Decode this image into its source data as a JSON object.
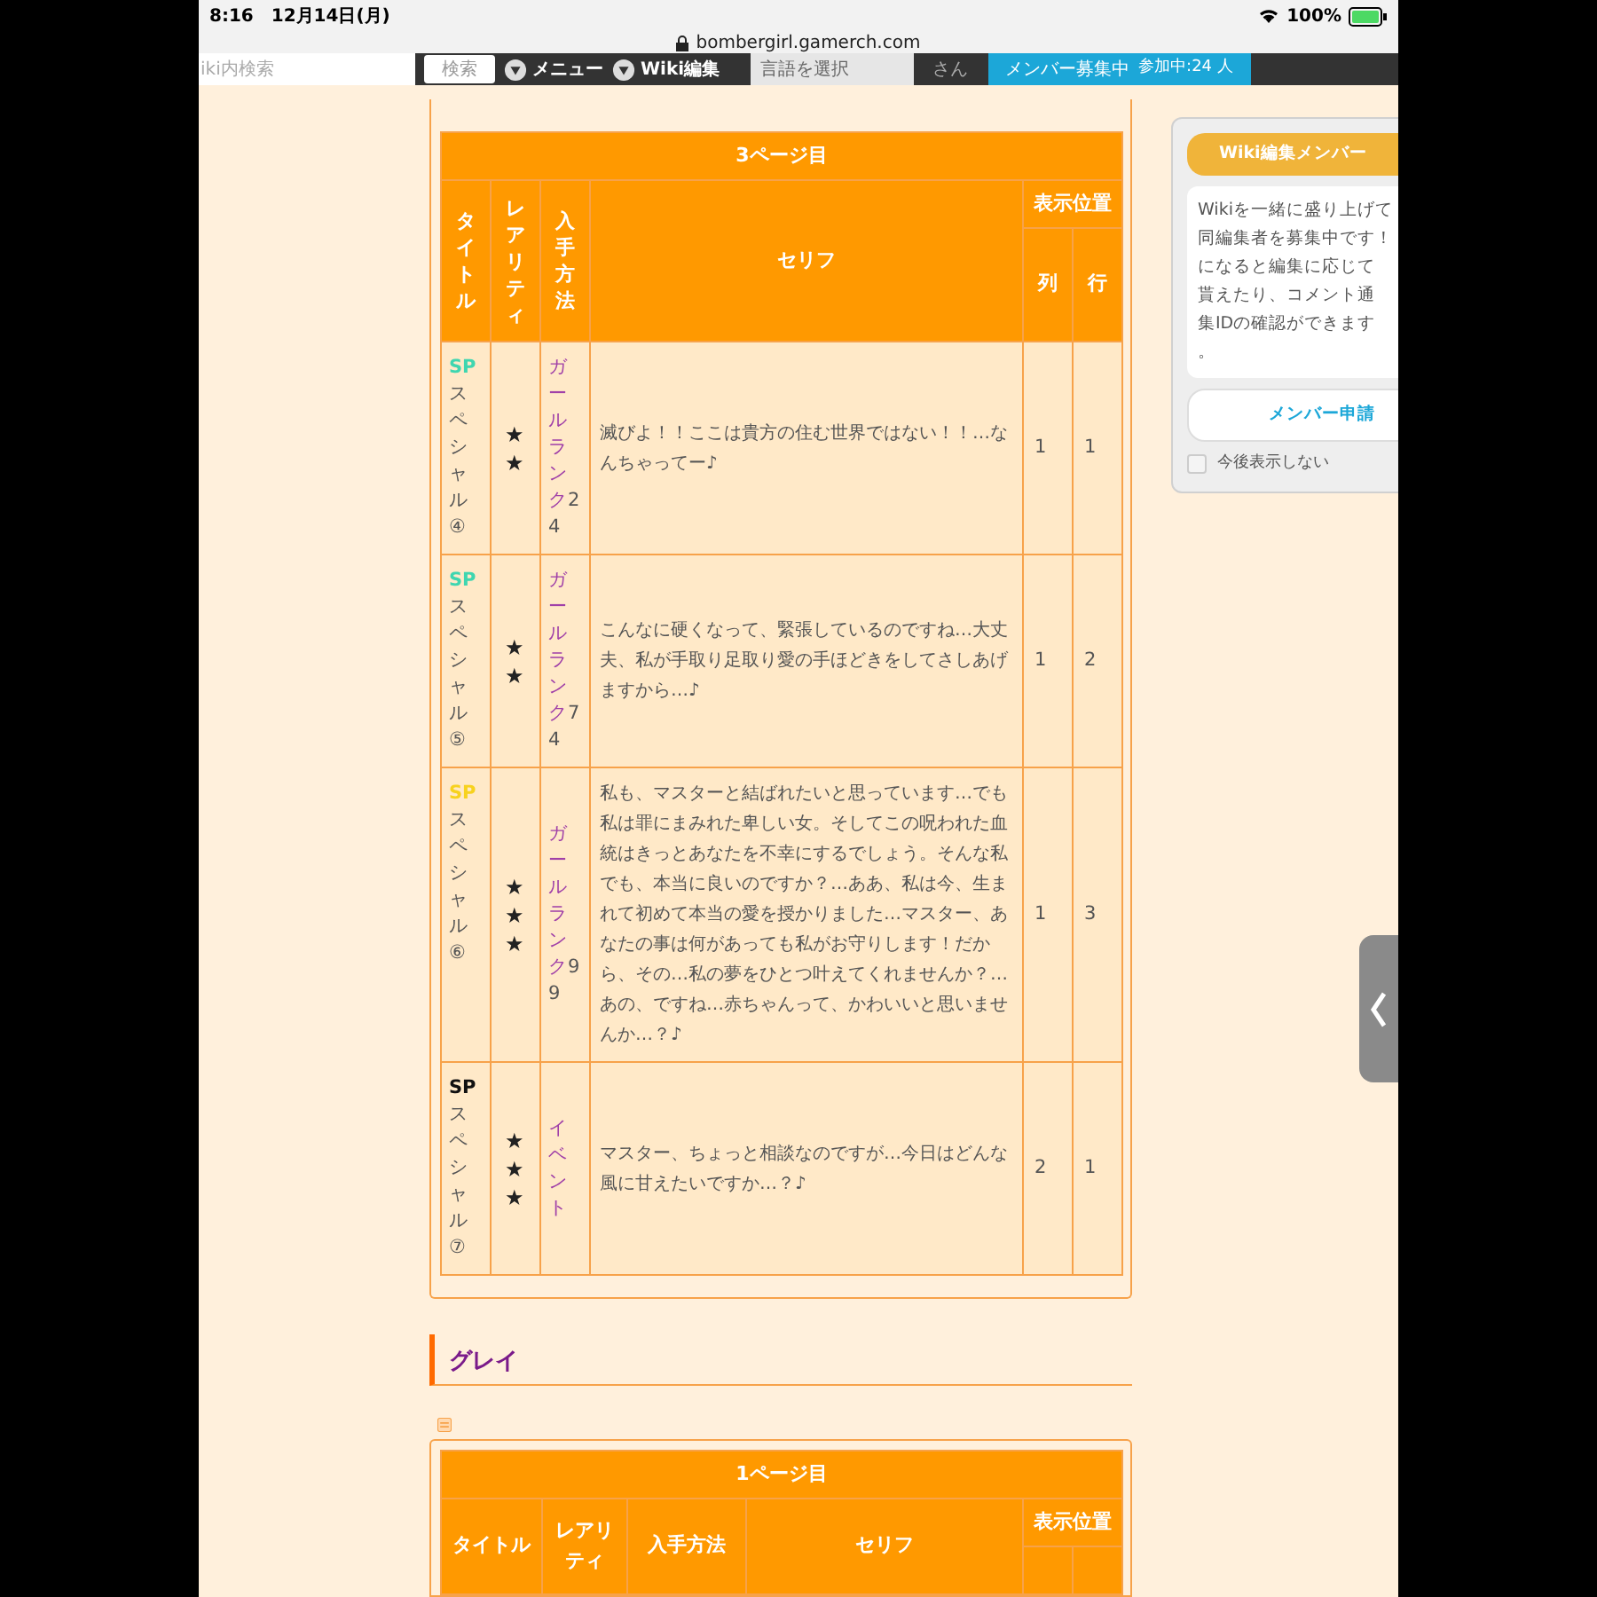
{
  "status_bar": {
    "time": "8:16",
    "date": "12月14日(月)",
    "battery": "100%"
  },
  "address_bar": {
    "url": "bombergirl.gamerch.com"
  },
  "nav": {
    "search_placeholder": "iki内検索",
    "search_button": "検索",
    "menus": [
      "メニュー",
      "Wiki編集"
    ],
    "language": "言語を選択",
    "user_suffix": "さん",
    "member_button": {
      "label": "メンバー募集中",
      "count": "参加中:24 人"
    }
  },
  "table_1": {
    "caption": "3ページ目",
    "headers": {
      "title": "タイトル",
      "rarity": "レアリティ",
      "method": "入手方法",
      "line": "セリフ",
      "position": "表示位置",
      "column": "列",
      "row": "行"
    },
    "rows": [
      {
        "sp": "SP",
        "color": "#3fd6b0",
        "name": "スペシャル④",
        "rarity": "★★",
        "method": "ガールランク",
        "method_value": "24",
        "line": "滅びよ！！ここは貴方の住む世界ではない！！…なんちゃってー♪",
        "column": "1",
        "row": "1"
      },
      {
        "sp": "SP",
        "color": "#3fd6b0",
        "name": "スペシャル⑤",
        "rarity": "★★",
        "method": "ガールランク",
        "method_value": "74",
        "line": "こんなに硬くなって、緊張しているのですね…大丈夫、私が手取り足取り愛の手ほどきをしてさしあげますから…♪",
        "column": "1",
        "row": "2"
      },
      {
        "sp": "SP",
        "color": "#f7d21e",
        "name": "スペシャル⑥",
        "rarity": "★★★",
        "method": "ガールランク",
        "method_value": "99",
        "line": "私も、マスターと結ばれたいと思っています…でも私は罪にまみれた卑しい女。そしてこの呪われた血統はきっとあなたを不幸にするでしょう。そんな私でも、本当に良いのですか？…ああ、私は今、生まれて初めて本当の愛を授かりました…マスター、あなたの事は何があっても私がお守りします！だから、その…私の夢をひとつ叶えてくれませんか？…あの、ですね…赤ちゃんって、かわいいと思いませんか…？♪",
        "column": "1",
        "row": "3"
      },
      {
        "sp": "SP",
        "color": "#111111",
        "name": "スペシャル⑦",
        "rarity": "★★★",
        "method": "イベント",
        "line": "マスター、ちょっと相談なのですが…今日はどんな風に甘えたいですか…？♪",
        "column": "2",
        "row": "1"
      }
    ]
  },
  "heading": "グレイ",
  "table_2": {
    "caption": "1ページ目",
    "headers": {
      "title": "タイトル",
      "rarity": "レアリティ",
      "method": "入手方法",
      "line": "セリフ",
      "position": "表示位置"
    }
  },
  "popup": {
    "title": "Wiki編集メンバー",
    "lines": [
      "Wikiを一緒に盛り上げて",
      "同編集者を募集中です！",
      "になると編集に応じて",
      "貰えたり、コメント通",
      "集IDの確認ができます",
      "。"
    ],
    "button": "メンバー申請",
    "checkbox": {
      "label": "今後表示しない",
      "checked": false
    }
  }
}
